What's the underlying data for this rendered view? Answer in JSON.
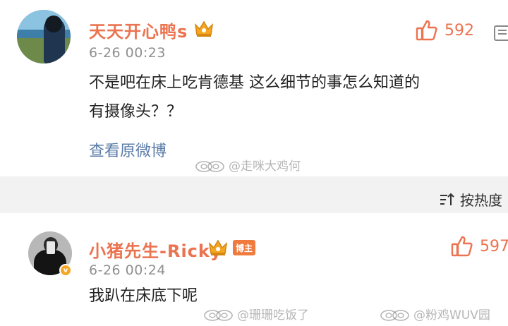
{
  "comments": [
    {
      "username": "天天开心鸭s",
      "time": "6-26 00:23",
      "text_line1": "不是吧在床上吃肯德基 这么细节的事怎么知道的",
      "text_line2": "有摄像头？？",
      "likes": "592",
      "view_original": "查看原微博"
    },
    {
      "username": "小猪先生-Ricky",
      "badge": "博主",
      "verified_mark": "v",
      "time": "6-26 00:24",
      "text": "我趴在床底下呢",
      "likes": "597"
    }
  ],
  "sort_label": "按热度",
  "watermarks": [
    "@走咪大鸡何",
    "@珊珊吃饭了",
    "@粉鸡WUV园"
  ],
  "colors": {
    "username": "#eb7350",
    "link": "#5b7ca8",
    "time": "#8f8f8f",
    "background": "#f2f2f2",
    "card": "#ffffff",
    "crown": "#f5a623"
  },
  "icons": [
    "thumbs-up-icon",
    "crown-icon",
    "more-icon",
    "sort-icon",
    "weibo-watermark-icon"
  ]
}
